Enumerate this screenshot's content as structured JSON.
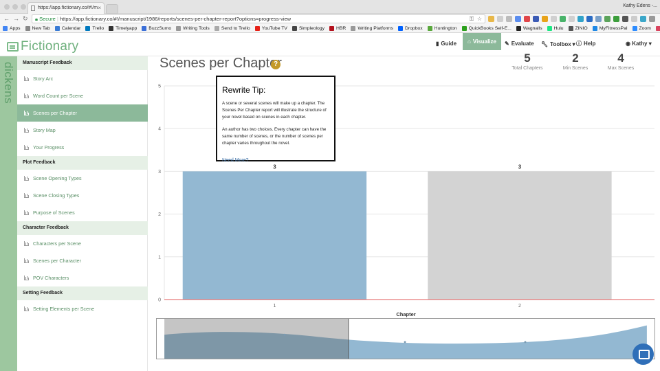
{
  "browser": {
    "tab_title": "https://app.fictionary.co/#!/m",
    "user_name": "Kathy Edens -...",
    "secure_label": "Secure",
    "url": "https://app.fictionary.co/#!/manuscript/1986/reports/scenes-per-chapter-report?options=progress-view",
    "bookmarks": [
      {
        "label": "Apps",
        "color": "#4285f4"
      },
      {
        "label": "New Tab",
        "color": "#888888"
      },
      {
        "label": "Calendar",
        "color": "#3a7bd5"
      },
      {
        "label": "Trello",
        "color": "#0079bf"
      },
      {
        "label": "Timelyapp",
        "color": "#333333"
      },
      {
        "label": "BuzzSumo",
        "color": "#3b6fd8"
      },
      {
        "label": "Writing Tools",
        "color": "#999999"
      },
      {
        "label": "Send to Trello",
        "color": "#aaaaaa"
      },
      {
        "label": "YouTube TV",
        "color": "#e62117"
      },
      {
        "label": "Simpleology",
        "color": "#444444"
      },
      {
        "label": "HBR",
        "color": "#b3111d"
      },
      {
        "label": "Writing Platforms",
        "color": "#999999"
      },
      {
        "label": "Dropbox",
        "color": "#0061fe"
      },
      {
        "label": "Huntington",
        "color": "#5aa83d"
      },
      {
        "label": "QuickBooks Self-E...",
        "color": "#2ca01c"
      },
      {
        "label": "Wagnalls",
        "color": "#222222"
      },
      {
        "label": "Hulu",
        "color": "#1ce783"
      },
      {
        "label": "ZINIO",
        "color": "#555555"
      },
      {
        "label": "MyFitnessPal",
        "color": "#1e88e5"
      },
      {
        "label": "Zoom",
        "color": "#2d8cff"
      },
      {
        "label": "Zenkit",
        "color": "#d9435e"
      }
    ]
  },
  "app": {
    "logo_text": "Fictionary",
    "manuscript_label": "dickens",
    "nav": {
      "guide": "Guide",
      "visualize": "Visualize",
      "evaluate": "Evaluate",
      "toolbox": "Toolbox",
      "help": "Help",
      "user": "Kathy"
    },
    "accent_color": "#8cb99a"
  },
  "sidebar": {
    "sections": [
      {
        "title": "Manuscript Feedback",
        "items": [
          "Story Arc",
          "Word Count per Scene",
          "Scenes per Chapter",
          "Story Map",
          "Your Progress"
        ]
      },
      {
        "title": "Plot Feedback",
        "items": [
          "Scene Opening Types",
          "Scene Closing Types",
          "Purpose of Scenes"
        ]
      },
      {
        "title": "Character Feedback",
        "items": [
          "Characters per Scene",
          "Scenes per Character",
          "POV Characters"
        ]
      },
      {
        "title": "Setting Feedback",
        "items": [
          "Setting Elements per Scene"
        ]
      }
    ],
    "active_item": "Scenes per Chapter"
  },
  "main": {
    "title": "Scenes per Chapter",
    "stats": [
      {
        "value": "5",
        "label": "Total Chapters"
      },
      {
        "value": "2",
        "label": "Min Scenes"
      },
      {
        "value": "4",
        "label": "Max Scenes"
      }
    ]
  },
  "tooltip": {
    "title": "Rewrite Tip:",
    "paragraph1": "A scene or several scenes will make up a chapter. The Scenes Per Chapter report will illustrate the structure of your novel based on scenes in each chapter.",
    "paragraph2": "An author has two choices. Every chapter can have the same number of scenes, or the number of scenes per chapter varies throughout the novel.",
    "link": "Need More?"
  },
  "chart_data": {
    "type": "bar",
    "categories": [
      "1",
      "2"
    ],
    "values": [
      3,
      3
    ],
    "data_labels": [
      "3",
      "3"
    ],
    "bar_colors": [
      "#93b8d2",
      "#d3d3d3"
    ],
    "xlabel": "Chapter",
    "ylabel": "",
    "ylim": [
      0,
      5
    ],
    "yticks": [
      "0",
      "1",
      "2",
      "3",
      "4",
      "5"
    ],
    "grid": true
  }
}
